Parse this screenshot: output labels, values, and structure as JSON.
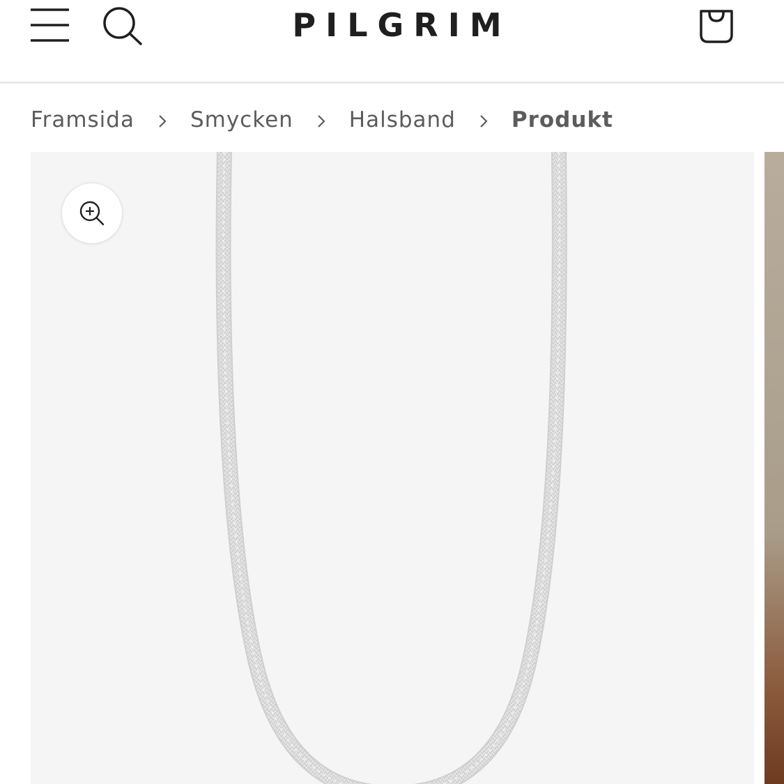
{
  "header": {
    "logo": "PILGRIM",
    "menu_icon": "hamburger-menu-icon",
    "search_icon": "search-icon",
    "cart_icon": "shopping-bag-icon"
  },
  "breadcrumb": {
    "items": [
      "Framsida",
      "Smycken",
      "Halsband"
    ],
    "current": "Produkt",
    "separator_icon": "chevron-right-icon"
  },
  "gallery": {
    "zoom_icon": "zoom-in-icon",
    "image_subject": "silver-herringbone-chain-necklace"
  },
  "colors": {
    "text": "#1f1f1f",
    "breadcrumb_text": "#5c5c5c",
    "gallery_bg": "#f5f5f5",
    "header_border": "#e8e8e8"
  }
}
